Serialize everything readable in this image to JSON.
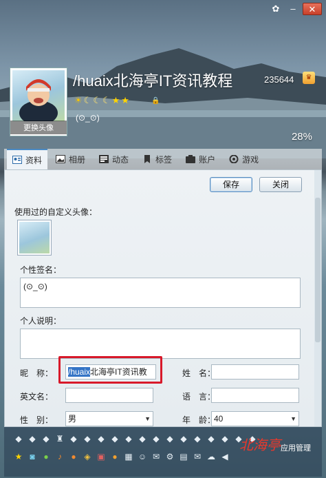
{
  "profile": {
    "nickname": "/huaix北海亭IT资讯教程",
    "qq_number": "235644",
    "signature": "(⊙_⊙)",
    "change_avatar": "更换头像",
    "progress_percent": "28%"
  },
  "tabs": [
    {
      "label": "资料",
      "icon": "profile-card-icon"
    },
    {
      "label": "相册",
      "icon": "photo-album-icon"
    },
    {
      "label": "动态",
      "icon": "feed-icon"
    },
    {
      "label": "标签",
      "icon": "bookmark-icon"
    },
    {
      "label": "账户",
      "icon": "wallet-icon"
    },
    {
      "label": "游戏",
      "icon": "game-icon"
    }
  ],
  "buttons": {
    "save": "保存",
    "close": "关闭"
  },
  "form": {
    "used_avatars_label": "使用过的自定义头像：",
    "signature_label": "个性签名：",
    "signature_value": "(⊙_⊙)",
    "intro_label": "个人说明：",
    "intro_value": "",
    "nickname_label": "昵　称：",
    "nickname_selected": "/huaix",
    "nickname_rest": "北海亭IT资讯教",
    "name_label": "姓　名：",
    "name_value": "",
    "english_label": "英文名：",
    "english_value": "",
    "language_label": "语　言：",
    "language_value": "",
    "gender_label": "性　别：",
    "gender_value": "男",
    "age_label": "年　龄：",
    "age_value": "40"
  },
  "watermark": {
    "brand": "北海亭",
    "app_manage": "应用管理"
  }
}
